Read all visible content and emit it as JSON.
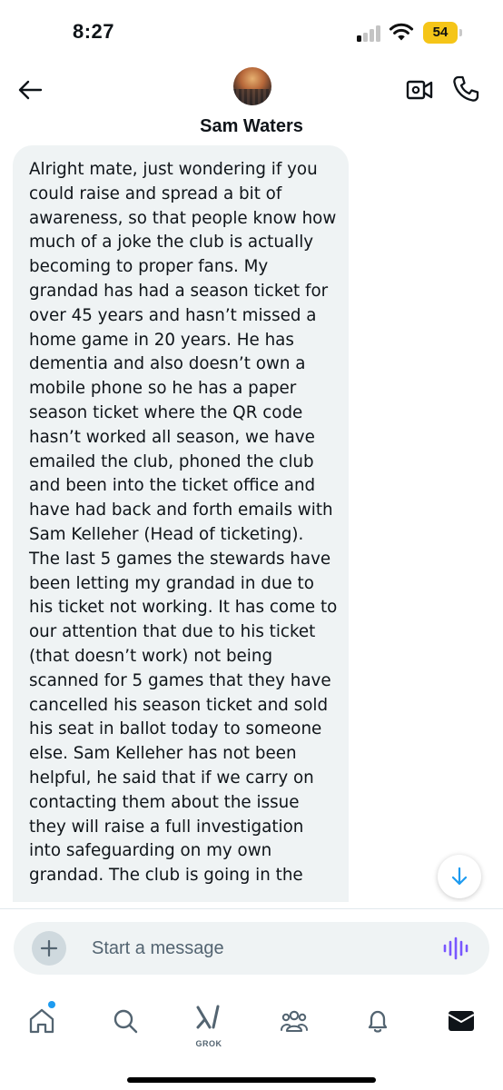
{
  "status_bar": {
    "time": "8:27",
    "battery_level": "54",
    "battery_color": "#f5c518"
  },
  "header": {
    "contact_name": "Sam Waters",
    "back_icon": "arrow-left-icon",
    "video_icon": "video-camera-icon",
    "call_icon": "phone-icon"
  },
  "message": {
    "text": "Alright mate, just wondering if you could raise and spread a bit of awareness, so that people know how much of a joke the club is actually becoming to proper fans. My grandad has had a season ticket for over 45 years and hasn’t missed a home game in 20 years. He has dementia and also doesn’t own a mobile phone so he has a paper season ticket where the QR code hasn’t worked all season, we have emailed the club, phoned the club and been into the ticket office and have had back and forth emails with Sam Kelleher (Head of ticketing). The last 5 games the stewards have been letting my grandad in due to his ticket not working. It has come to our attention that due to his ticket (that doesn’t work) not being scanned for 5 games that they have cancelled his season ticket and sold his seat in ballot today to someone else. Sam Kelleher has not been helpful, he said that if we carry on contacting them about the issue they will raise a full investigation into safeguarding on my own grandad. The club is going in the"
  },
  "composer": {
    "placeholder": "Start a message",
    "add_icon": "plus-icon",
    "voice_icon": "voice-wave-icon"
  },
  "bottom_nav": {
    "items": [
      {
        "name": "home",
        "icon": "home-icon"
      },
      {
        "name": "search",
        "icon": "search-icon"
      },
      {
        "name": "grok",
        "icon": "grok-icon",
        "label": "GROK"
      },
      {
        "name": "communities",
        "icon": "people-icon"
      },
      {
        "name": "notifications",
        "icon": "bell-icon"
      },
      {
        "name": "messages",
        "icon": "envelope-icon"
      }
    ]
  },
  "colors": {
    "accent": "#1d9bf0",
    "bubble": "#eff3f4",
    "voice": "#7856ff"
  }
}
